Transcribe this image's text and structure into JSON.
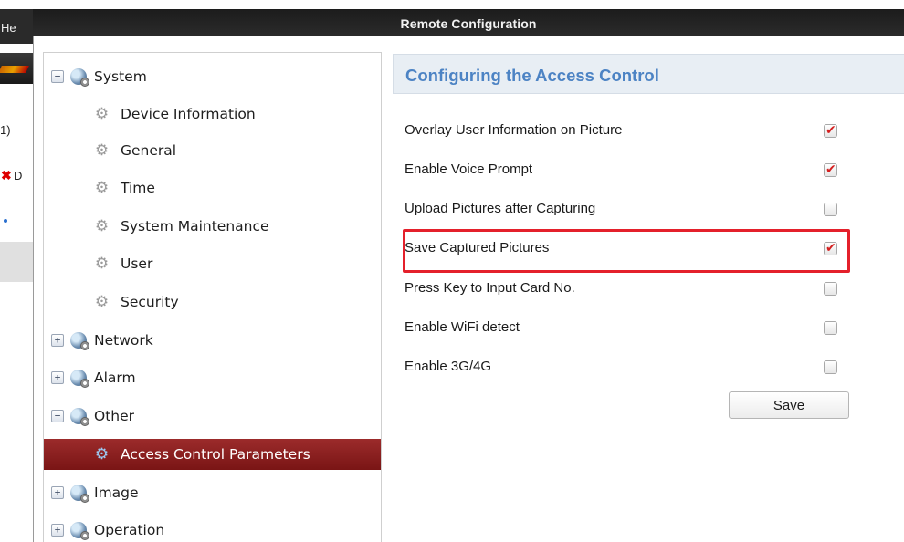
{
  "window": {
    "title": "Remote Configuration"
  },
  "background_app": {
    "menu_label": "He",
    "tab_label": "1)",
    "x_label": "D"
  },
  "tree": {
    "items": [
      {
        "label": "System",
        "level": 0,
        "toggle": "−",
        "expanded": true
      },
      {
        "label": "Device Information",
        "level": 1
      },
      {
        "label": "General",
        "level": 1
      },
      {
        "label": "Time",
        "level": 1
      },
      {
        "label": "System Maintenance",
        "level": 1
      },
      {
        "label": "User",
        "level": 1
      },
      {
        "label": "Security",
        "level": 1
      },
      {
        "label": "Network",
        "level": 0,
        "toggle": "+",
        "expanded": false
      },
      {
        "label": "Alarm",
        "level": 0,
        "toggle": "+",
        "expanded": false
      },
      {
        "label": "Other",
        "level": 0,
        "toggle": "−",
        "expanded": true
      },
      {
        "label": "Access Control Parameters",
        "level": 1,
        "selected": true
      },
      {
        "label": "Image",
        "level": 0,
        "toggle": "+",
        "expanded": false
      },
      {
        "label": "Operation",
        "level": 0,
        "toggle": "+",
        "expanded": false
      }
    ]
  },
  "content": {
    "section_title": "Configuring the Access Control",
    "settings": [
      {
        "label": "Overlay User Information on Picture",
        "checked": true
      },
      {
        "label": "Enable Voice Prompt",
        "checked": true
      },
      {
        "label": "Upload Pictures after Capturing",
        "checked": false
      },
      {
        "label": "Save Captured Pictures",
        "checked": true,
        "highlighted": true
      },
      {
        "label": "Press Key to Input Card No.",
        "checked": false
      },
      {
        "label": "Enable WiFi detect",
        "checked": false
      },
      {
        "label": "Enable 3G/4G",
        "checked": false
      }
    ],
    "save_label": "Save"
  },
  "colors": {
    "accent_title": "#4c83c4",
    "selected_row": "#7a1515",
    "highlight_box": "#e4202b",
    "check_mark": "#d42020"
  }
}
